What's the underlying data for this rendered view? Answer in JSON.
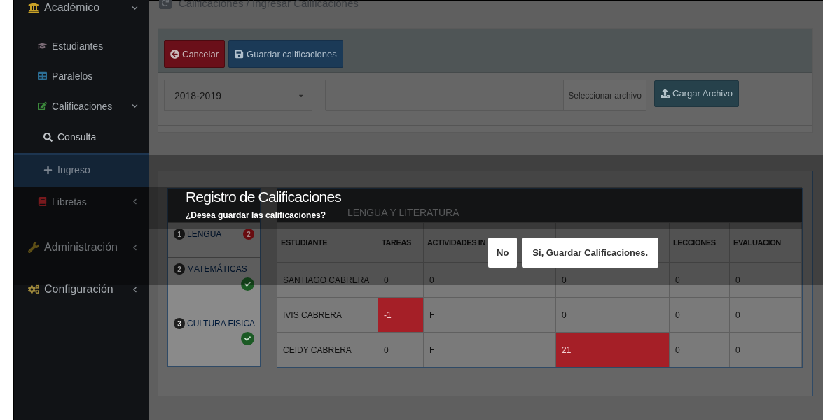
{
  "sidebar": {
    "items": [
      {
        "label": "Académico",
        "expanded": true,
        "selected": false,
        "children": [
          {
            "label": "Estudiantes",
            "selected": false
          },
          {
            "label": "Paralelos",
            "selected": false
          },
          {
            "label": "Calificaciones",
            "expanded": true,
            "selected": false,
            "children": [
              {
                "label": "Consulta",
                "selected": false
              },
              {
                "label": "Ingreso",
                "selected": true
              }
            ]
          },
          {
            "label": "Libretas",
            "expanded": false,
            "selected": false
          }
        ]
      },
      {
        "label": "Administración",
        "expanded": false,
        "selected": false
      },
      {
        "label": "Configuración",
        "expanded": false,
        "selected": false
      }
    ]
  },
  "breadcrumb": "Calificaciones / Ingresar Calificaciones",
  "toolbar": {
    "buttons": [
      {
        "label": "Cancelar",
        "kind": "cancel"
      },
      {
        "label": "Guardar calificaciones",
        "kind": "save"
      }
    ]
  },
  "period_select": {
    "value": "2018-2019"
  },
  "file_field": {
    "button": "Seleccionar archivo"
  },
  "upload_button": "Cargar Archivo",
  "subjects": {
    "items": [
      {
        "number": "1",
        "name": "LENGUA",
        "kind": "errors",
        "badge": "2"
      },
      {
        "number": "2",
        "name": "MATEMÁTICAS",
        "kind": "done"
      },
      {
        "number": "3",
        "name": "CULTURA FISICA",
        "kind": "done"
      }
    ]
  },
  "grades": {
    "title": "LENGUA Y LITERATURA",
    "columns": [
      {
        "label": "ESTUDIANTE"
      },
      {
        "label": "TAREAS"
      },
      {
        "label": "ACTIVIDADES IN"
      },
      {},
      {
        "label": "LECCIONES"
      },
      {
        "label": "EVALUACION"
      }
    ],
    "rows": [
      {
        "cells": [
          {
            "value": "SANTIAGO CABRERA",
            "error": false
          },
          {
            "value": "0",
            "error": false
          },
          {
            "value": "0",
            "error": false
          },
          {
            "value": "0",
            "error": false
          },
          {
            "value": "0",
            "error": false
          },
          {
            "value": "0",
            "error": false
          }
        ]
      },
      {
        "cells": [
          {
            "value": "IVIS CABRERA",
            "error": false
          },
          {
            "value": "-1",
            "error": true
          },
          {
            "value": "F",
            "error": false
          },
          {
            "value": "0",
            "error": false
          },
          {
            "value": "0",
            "error": false
          },
          {
            "value": "0",
            "error": false
          }
        ]
      },
      {
        "cells": [
          {
            "value": "CEIDY CABRERA",
            "error": false
          },
          {
            "value": "0",
            "error": false
          },
          {
            "value": "F",
            "error": false
          },
          {
            "value": "21",
            "error": true
          },
          {
            "value": "0",
            "error": false
          },
          {
            "value": "0",
            "error": false
          }
        ]
      }
    ]
  },
  "modal": {
    "title": "Registro de Calificaciones",
    "message": "¿Desea guardar las calificaciones?",
    "buttons": [
      {
        "label": "No",
        "kind": "cancel"
      },
      {
        "label": "Si, Guardar Calificaciones.",
        "kind": "confirm"
      }
    ]
  }
}
